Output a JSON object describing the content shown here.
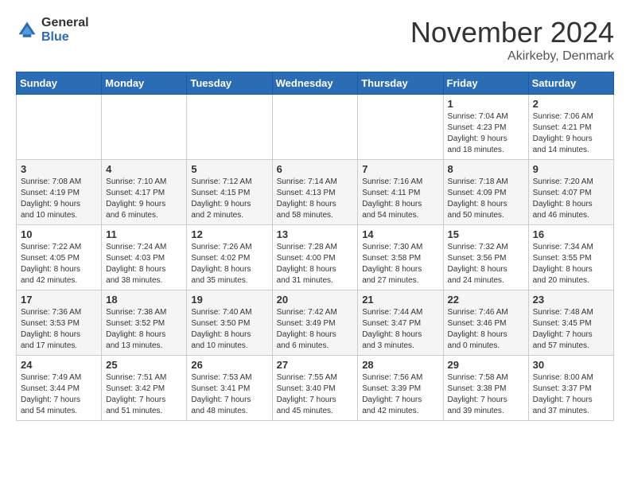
{
  "logo": {
    "general": "General",
    "blue": "Blue"
  },
  "title": {
    "month_year": "November 2024",
    "location": "Akirkeby, Denmark"
  },
  "weekdays": [
    "Sunday",
    "Monday",
    "Tuesday",
    "Wednesday",
    "Thursday",
    "Friday",
    "Saturday"
  ],
  "weeks": [
    [
      {
        "day": "",
        "info": ""
      },
      {
        "day": "",
        "info": ""
      },
      {
        "day": "",
        "info": ""
      },
      {
        "day": "",
        "info": ""
      },
      {
        "day": "",
        "info": ""
      },
      {
        "day": "1",
        "info": "Sunrise: 7:04 AM\nSunset: 4:23 PM\nDaylight: 9 hours\nand 18 minutes."
      },
      {
        "day": "2",
        "info": "Sunrise: 7:06 AM\nSunset: 4:21 PM\nDaylight: 9 hours\nand 14 minutes."
      }
    ],
    [
      {
        "day": "3",
        "info": "Sunrise: 7:08 AM\nSunset: 4:19 PM\nDaylight: 9 hours\nand 10 minutes."
      },
      {
        "day": "4",
        "info": "Sunrise: 7:10 AM\nSunset: 4:17 PM\nDaylight: 9 hours\nand 6 minutes."
      },
      {
        "day": "5",
        "info": "Sunrise: 7:12 AM\nSunset: 4:15 PM\nDaylight: 9 hours\nand 2 minutes."
      },
      {
        "day": "6",
        "info": "Sunrise: 7:14 AM\nSunset: 4:13 PM\nDaylight: 8 hours\nand 58 minutes."
      },
      {
        "day": "7",
        "info": "Sunrise: 7:16 AM\nSunset: 4:11 PM\nDaylight: 8 hours\nand 54 minutes."
      },
      {
        "day": "8",
        "info": "Sunrise: 7:18 AM\nSunset: 4:09 PM\nDaylight: 8 hours\nand 50 minutes."
      },
      {
        "day": "9",
        "info": "Sunrise: 7:20 AM\nSunset: 4:07 PM\nDaylight: 8 hours\nand 46 minutes."
      }
    ],
    [
      {
        "day": "10",
        "info": "Sunrise: 7:22 AM\nSunset: 4:05 PM\nDaylight: 8 hours\nand 42 minutes."
      },
      {
        "day": "11",
        "info": "Sunrise: 7:24 AM\nSunset: 4:03 PM\nDaylight: 8 hours\nand 38 minutes."
      },
      {
        "day": "12",
        "info": "Sunrise: 7:26 AM\nSunset: 4:02 PM\nDaylight: 8 hours\nand 35 minutes."
      },
      {
        "day": "13",
        "info": "Sunrise: 7:28 AM\nSunset: 4:00 PM\nDaylight: 8 hours\nand 31 minutes."
      },
      {
        "day": "14",
        "info": "Sunrise: 7:30 AM\nSunset: 3:58 PM\nDaylight: 8 hours\nand 27 minutes."
      },
      {
        "day": "15",
        "info": "Sunrise: 7:32 AM\nSunset: 3:56 PM\nDaylight: 8 hours\nand 24 minutes."
      },
      {
        "day": "16",
        "info": "Sunrise: 7:34 AM\nSunset: 3:55 PM\nDaylight: 8 hours\nand 20 minutes."
      }
    ],
    [
      {
        "day": "17",
        "info": "Sunrise: 7:36 AM\nSunset: 3:53 PM\nDaylight: 8 hours\nand 17 minutes."
      },
      {
        "day": "18",
        "info": "Sunrise: 7:38 AM\nSunset: 3:52 PM\nDaylight: 8 hours\nand 13 minutes."
      },
      {
        "day": "19",
        "info": "Sunrise: 7:40 AM\nSunset: 3:50 PM\nDaylight: 8 hours\nand 10 minutes."
      },
      {
        "day": "20",
        "info": "Sunrise: 7:42 AM\nSunset: 3:49 PM\nDaylight: 8 hours\nand 6 minutes."
      },
      {
        "day": "21",
        "info": "Sunrise: 7:44 AM\nSunset: 3:47 PM\nDaylight: 8 hours\nand 3 minutes."
      },
      {
        "day": "22",
        "info": "Sunrise: 7:46 AM\nSunset: 3:46 PM\nDaylight: 8 hours\nand 0 minutes."
      },
      {
        "day": "23",
        "info": "Sunrise: 7:48 AM\nSunset: 3:45 PM\nDaylight: 7 hours\nand 57 minutes."
      }
    ],
    [
      {
        "day": "24",
        "info": "Sunrise: 7:49 AM\nSunset: 3:44 PM\nDaylight: 7 hours\nand 54 minutes."
      },
      {
        "day": "25",
        "info": "Sunrise: 7:51 AM\nSunset: 3:42 PM\nDaylight: 7 hours\nand 51 minutes."
      },
      {
        "day": "26",
        "info": "Sunrise: 7:53 AM\nSunset: 3:41 PM\nDaylight: 7 hours\nand 48 minutes."
      },
      {
        "day": "27",
        "info": "Sunrise: 7:55 AM\nSunset: 3:40 PM\nDaylight: 7 hours\nand 45 minutes."
      },
      {
        "day": "28",
        "info": "Sunrise: 7:56 AM\nSunset: 3:39 PM\nDaylight: 7 hours\nand 42 minutes."
      },
      {
        "day": "29",
        "info": "Sunrise: 7:58 AM\nSunset: 3:38 PM\nDaylight: 7 hours\nand 39 minutes."
      },
      {
        "day": "30",
        "info": "Sunrise: 8:00 AM\nSunset: 3:37 PM\nDaylight: 7 hours\nand 37 minutes."
      }
    ]
  ]
}
